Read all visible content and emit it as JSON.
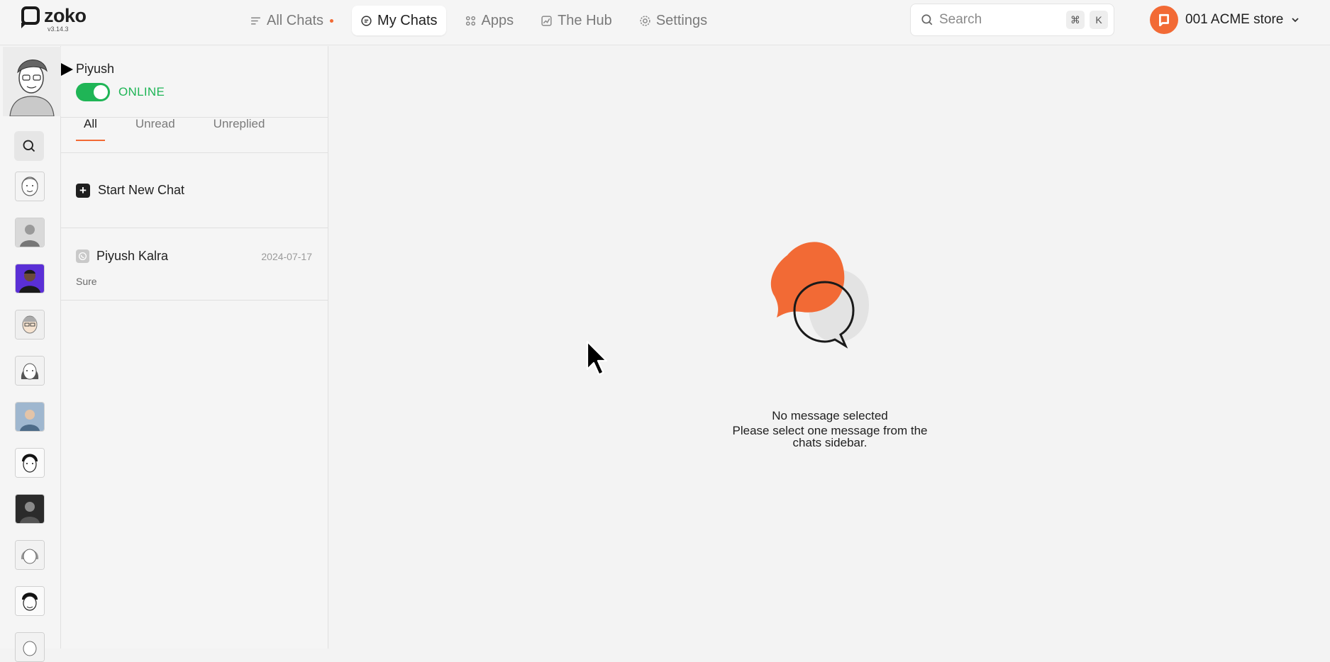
{
  "app": {
    "logo_text": "zoko",
    "version": "v3.14.3"
  },
  "nav": {
    "items": [
      {
        "label": "All Chats",
        "icon": "list-icon",
        "has_dot": true,
        "active": false
      },
      {
        "label": "My Chats",
        "icon": "chat-bubble-icon",
        "active": true
      },
      {
        "label": "Apps",
        "icon": "grid-icon",
        "active": false
      },
      {
        "label": "The Hub",
        "icon": "chart-icon",
        "active": false
      },
      {
        "label": "Settings",
        "icon": "gear-icon",
        "active": false
      }
    ]
  },
  "search": {
    "placeholder": "Search",
    "shortcut_keys": [
      "⌘",
      "K"
    ]
  },
  "store": {
    "name": "001 ACME store"
  },
  "agent": {
    "name": "Piyush",
    "status": "ONLINE",
    "online": true
  },
  "tabs": [
    {
      "label": "All",
      "active": true
    },
    {
      "label": "Unread",
      "active": false
    },
    {
      "label": "Unreplied",
      "active": false
    }
  ],
  "new_chat": {
    "label": "Start New Chat"
  },
  "chats": [
    {
      "name": "Piyush Kalra",
      "date": "2024-07-17",
      "last_message": "Sure",
      "channel": "whatsapp-icon"
    }
  ],
  "empty_state": {
    "title": "No message selected",
    "subtitle_line1": "Please select one message from the",
    "subtitle_line2": "chats sidebar."
  },
  "colors": {
    "accent": "#f26a35",
    "online": "#1fb556",
    "background": "#f3f3f3"
  }
}
